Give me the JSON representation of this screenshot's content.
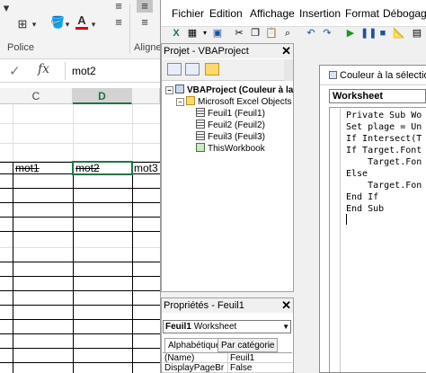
{
  "excel": {
    "ribbon": {
      "group_police": "Police",
      "group_alignment": "Alignem"
    },
    "formula_bar": {
      "value": "mot2"
    },
    "columns": [
      "C",
      "D"
    ],
    "selected_column": "D",
    "cells": {
      "c": "mot1",
      "d": "mot2",
      "e": "mot3"
    }
  },
  "vba": {
    "menu": [
      "Fichier",
      "Edition",
      "Affichage",
      "Insertion",
      "Format",
      "Débogage"
    ],
    "project_explorer": {
      "title": "Projet - VBAProject",
      "root": "VBAProject (Couleur à la",
      "folder": "Microsoft Excel Objects",
      "items": [
        "Feuil1 (Feuil1)",
        "Feuil2 (Feuil2)",
        "Feuil3 (Feuil3)",
        "ThisWorkbook"
      ]
    },
    "properties": {
      "title": "Propriétés - Feuil1",
      "object_name": "Feuil1",
      "object_type": "Worksheet",
      "tab_alpha": "Alphabétique",
      "tab_category": "Par catégorie",
      "rows": [
        {
          "name": "(Name)",
          "value": "Feuil1"
        },
        {
          "name": "DisplayPageBreak",
          "value": "False"
        }
      ]
    },
    "code_window": {
      "title": "Couleur à la sélection.x",
      "object": "Worksheet",
      "lines": [
        "Private Sub Wo",
        "Set plage = Un",
        "If Intersect(T",
        "If Target.Font",
        "    Target.Fon",
        "Else",
        "    Target.Fon",
        "End If",
        "End Sub"
      ]
    }
  }
}
